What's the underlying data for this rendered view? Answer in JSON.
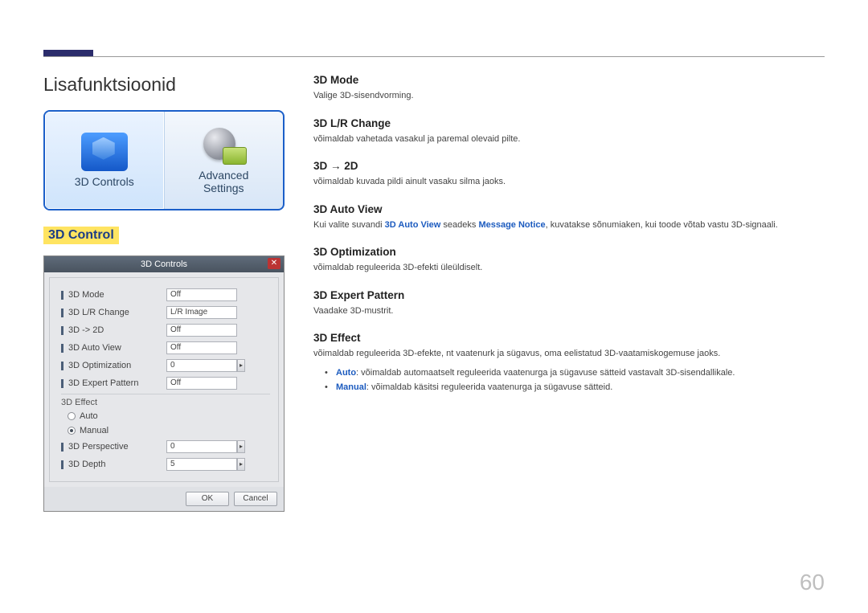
{
  "page_number": "60",
  "heading": "Lisafunktsioonid",
  "section_title": "3D Control",
  "tabs": {
    "left_label": "3D Controls",
    "right_line1": "Advanced",
    "right_line2": "Settings"
  },
  "dialog": {
    "title": "3D Controls",
    "rows": [
      {
        "label": "3D Mode",
        "value": "Off"
      },
      {
        "label": "3D L/R Change",
        "value": "L/R Image"
      },
      {
        "label": "3D -> 2D",
        "value": "Off"
      },
      {
        "label": "3D Auto View",
        "value": "Off"
      },
      {
        "label": "3D Optimization",
        "value": "0",
        "spinner": true
      },
      {
        "label": "3D Expert Pattern",
        "value": "Off"
      }
    ],
    "effect_section": "3D Effect",
    "radios": {
      "auto": "Auto",
      "manual": "Manual",
      "selected": "manual"
    },
    "sub_rows": [
      {
        "label": "3D Perspective",
        "value": "0",
        "spinner": true
      },
      {
        "label": "3D Depth",
        "value": "5",
        "spinner": true
      }
    ],
    "buttons": {
      "ok": "OK",
      "cancel": "Cancel"
    }
  },
  "right": {
    "h1": "3D Mode",
    "p1": "Valige 3D-sisendvorming.",
    "h2": "3D L/R Change",
    "p2": "võimaldab vahetada vasakul ja paremal olevaid pilte.",
    "h3": "3D → 2D",
    "p3": "võimaldab kuvada pildi ainult vasaku silma jaoks.",
    "h4": "3D Auto View",
    "p4_pre": "Kui valite suvandi ",
    "p4_b1": "3D Auto View",
    "p4_mid": " seadeks ",
    "p4_b2": "Message Notice",
    "p4_post": ", kuvatakse sõnumiaken, kui toode võtab vastu 3D-signaali.",
    "h5": "3D Optimization",
    "p5": "võimaldab reguleerida 3D-efekti üleüldiselt.",
    "h6": "3D Expert Pattern",
    "p6": "Vaadake 3D-mustrit.",
    "h7": "3D Effect",
    "p7": "võimaldab reguleerida 3D-efekte, nt vaatenurk ja sügavus, oma eelistatud 3D-vaatamiskogemuse jaoks.",
    "li1_b": "Auto",
    "li1": ": võimaldab automaatselt reguleerida vaatenurga ja sügavuse sätteid vastavalt 3D-sisendallikale.",
    "li2_b": "Manual",
    "li2": ": võimaldab käsitsi reguleerida vaatenurga ja sügavuse sätteid."
  }
}
